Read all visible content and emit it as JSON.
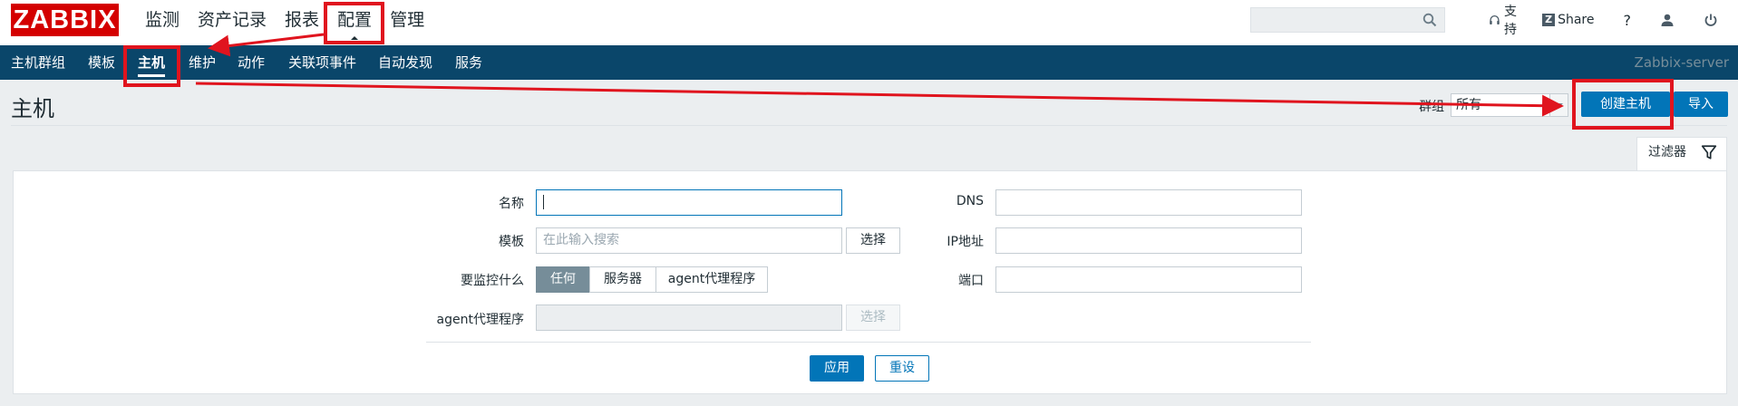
{
  "logo": "ZABBIX",
  "main_menu": [
    {
      "label": "监测"
    },
    {
      "label": "资产记录"
    },
    {
      "label": "报表"
    },
    {
      "label": "配置"
    },
    {
      "label": "管理"
    }
  ],
  "top_links": {
    "support": "支持",
    "share": "Share",
    "help": "?"
  },
  "sub_menu": [
    {
      "label": "主机群组"
    },
    {
      "label": "模板"
    },
    {
      "label": "主机"
    },
    {
      "label": "维护"
    },
    {
      "label": "动作"
    },
    {
      "label": "关联项事件"
    },
    {
      "label": "自动发现"
    },
    {
      "label": "服务"
    }
  ],
  "server_name": "Zabbix-server",
  "page_title": "主机",
  "group_filter": {
    "label": "群组",
    "value": "所有"
  },
  "buttons": {
    "create_host": "创建主机",
    "import": "导入"
  },
  "filter_tab": {
    "label": "过滤器"
  },
  "filter": {
    "name_label": "名称",
    "name_value": "",
    "template_label": "模板",
    "template_placeholder": "在此输入搜索",
    "select_label": "选择",
    "monitored_by_label": "要监控什么",
    "monitored_by_options": [
      "任何",
      "服务器",
      "agent代理程序"
    ],
    "proxy_label": "agent代理程序",
    "proxy_select_label": "选择",
    "dns_label": "DNS",
    "ip_label": "IP地址",
    "port_label": "端口",
    "apply_label": "应用",
    "reset_label": "重设"
  },
  "colors": {
    "logo_red": "#d40000",
    "subnav_bg": "#0a466a",
    "primary": "#0275b8",
    "annotation": "#e0141e"
  }
}
